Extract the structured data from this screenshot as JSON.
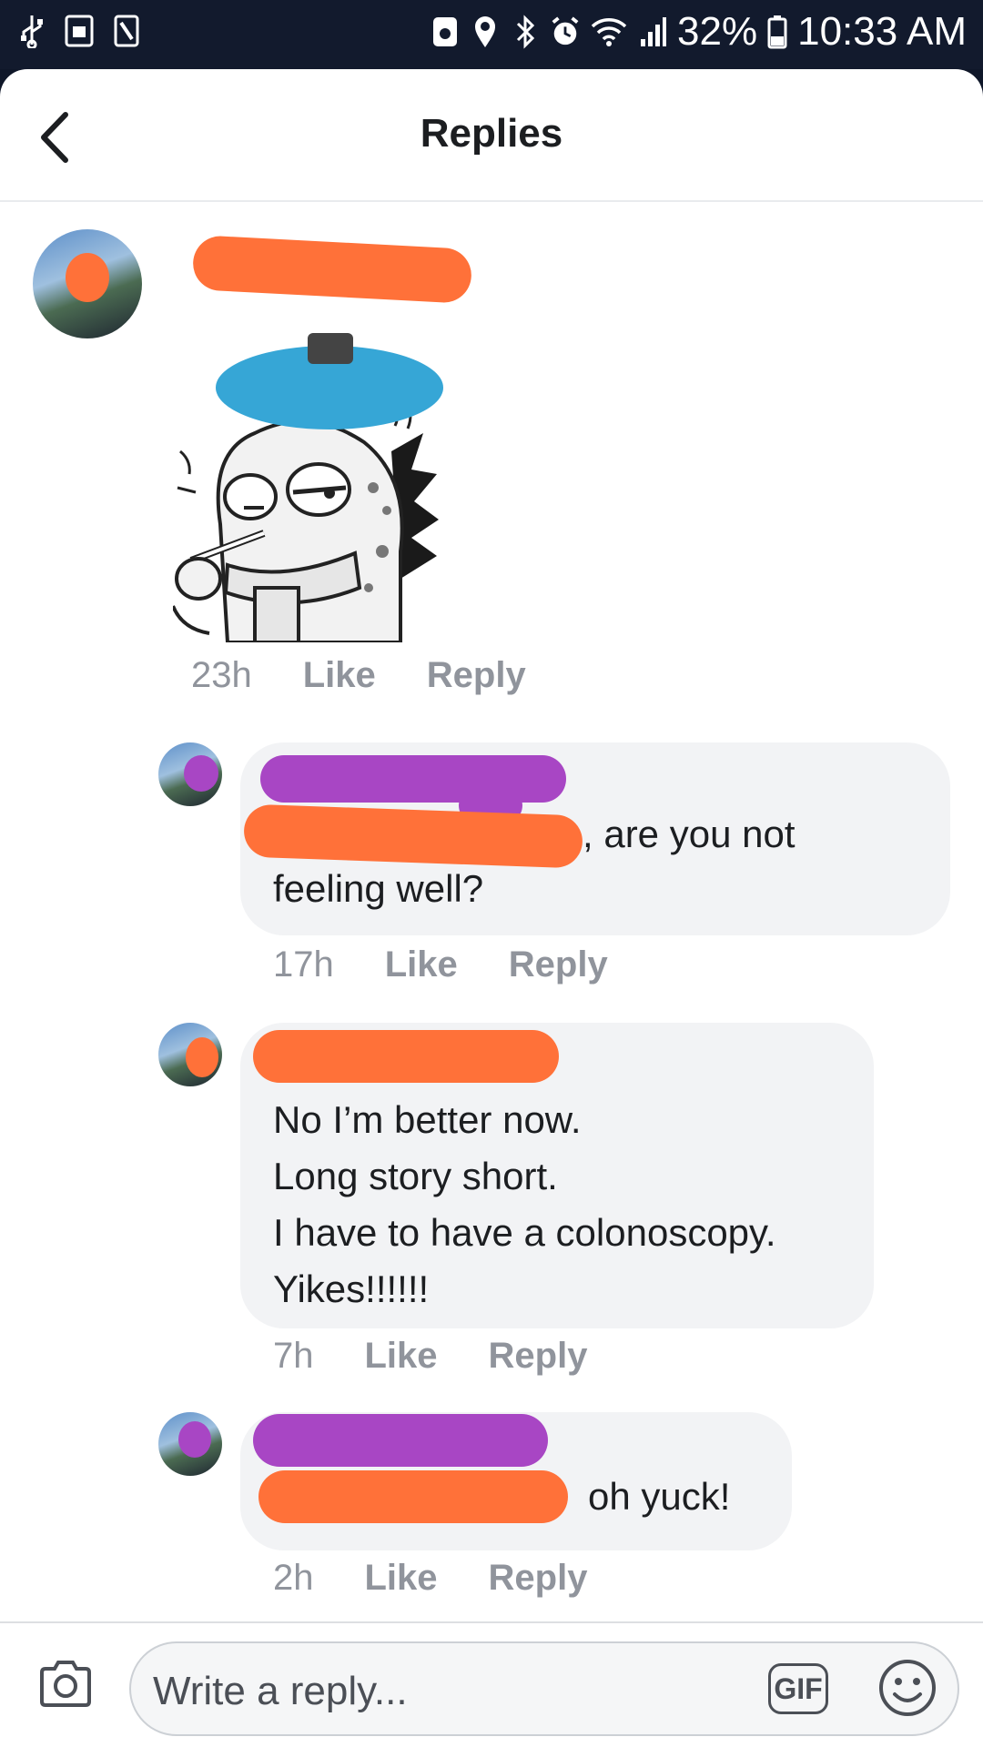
{
  "status_bar": {
    "battery": "32%",
    "time": "10:33 AM"
  },
  "header": {
    "title": "Replies"
  },
  "post": {
    "time": "23h",
    "like": "Like",
    "reply": "Reply"
  },
  "comments": [
    {
      "text_line1": ", are you not",
      "text_rest": "feeling well?",
      "time": "17h",
      "like": "Like",
      "reply": "Reply"
    },
    {
      "text": "No I’m better now.\nLong story short.\nI have to have a colonoscopy.\nYikes!!!!!!",
      "time": "7h",
      "like": "Like",
      "reply": "Reply"
    },
    {
      "text": "oh yuck!",
      "time": "2h",
      "like": "Like",
      "reply": "Reply"
    }
  ],
  "footer": {
    "placeholder": "Write a reply...",
    "gif": "GIF"
  },
  "icons": {
    "back": "back-arrow-icon",
    "camera": "camera-icon",
    "emoji": "smiley-icon"
  },
  "colors": {
    "redaction_orange": "#ff7139",
    "redaction_purple": "#a846c4",
    "meta_gray": "#90949c"
  }
}
